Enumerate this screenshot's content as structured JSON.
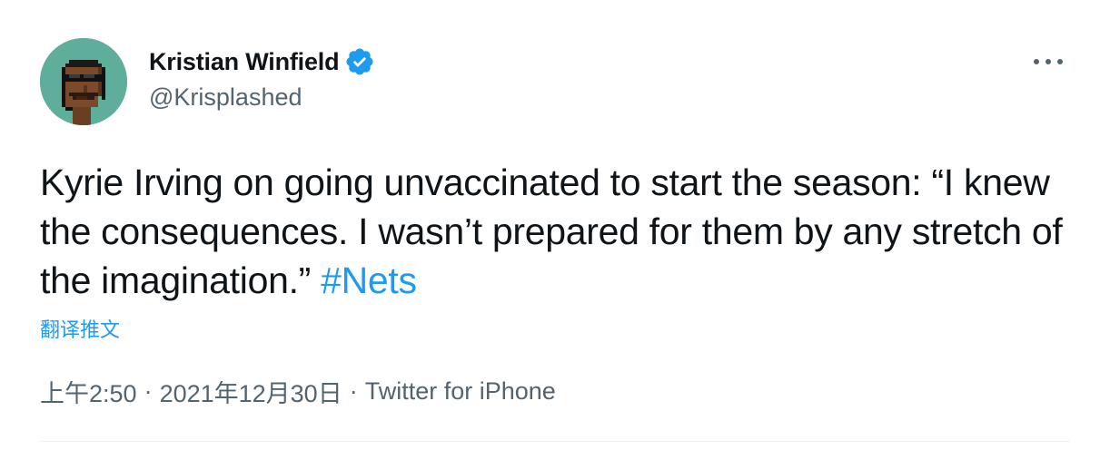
{
  "author": {
    "display_name": "Kristian Winfield",
    "handle": "@Krisplashed",
    "verified": true
  },
  "tweet": {
    "text": "Kyrie Irving on going unvaccinated to start the season: “I knew the consequences. I wasn’t prepared for them by any stretch of the imagination.” ",
    "hashtag": "#Nets"
  },
  "translate_label": "翻译推文",
  "meta": {
    "time": "上午2:50",
    "date": "2021年12月30日",
    "source": "Twitter for iPhone",
    "separator": "·"
  },
  "icons": {
    "verified": "verified-badge-icon",
    "more": "more-options-icon"
  },
  "colors": {
    "accent": "#1d9bf0",
    "text": "#0f1419",
    "secondary": "#536471",
    "avatar_bg": "#5fae9c"
  }
}
